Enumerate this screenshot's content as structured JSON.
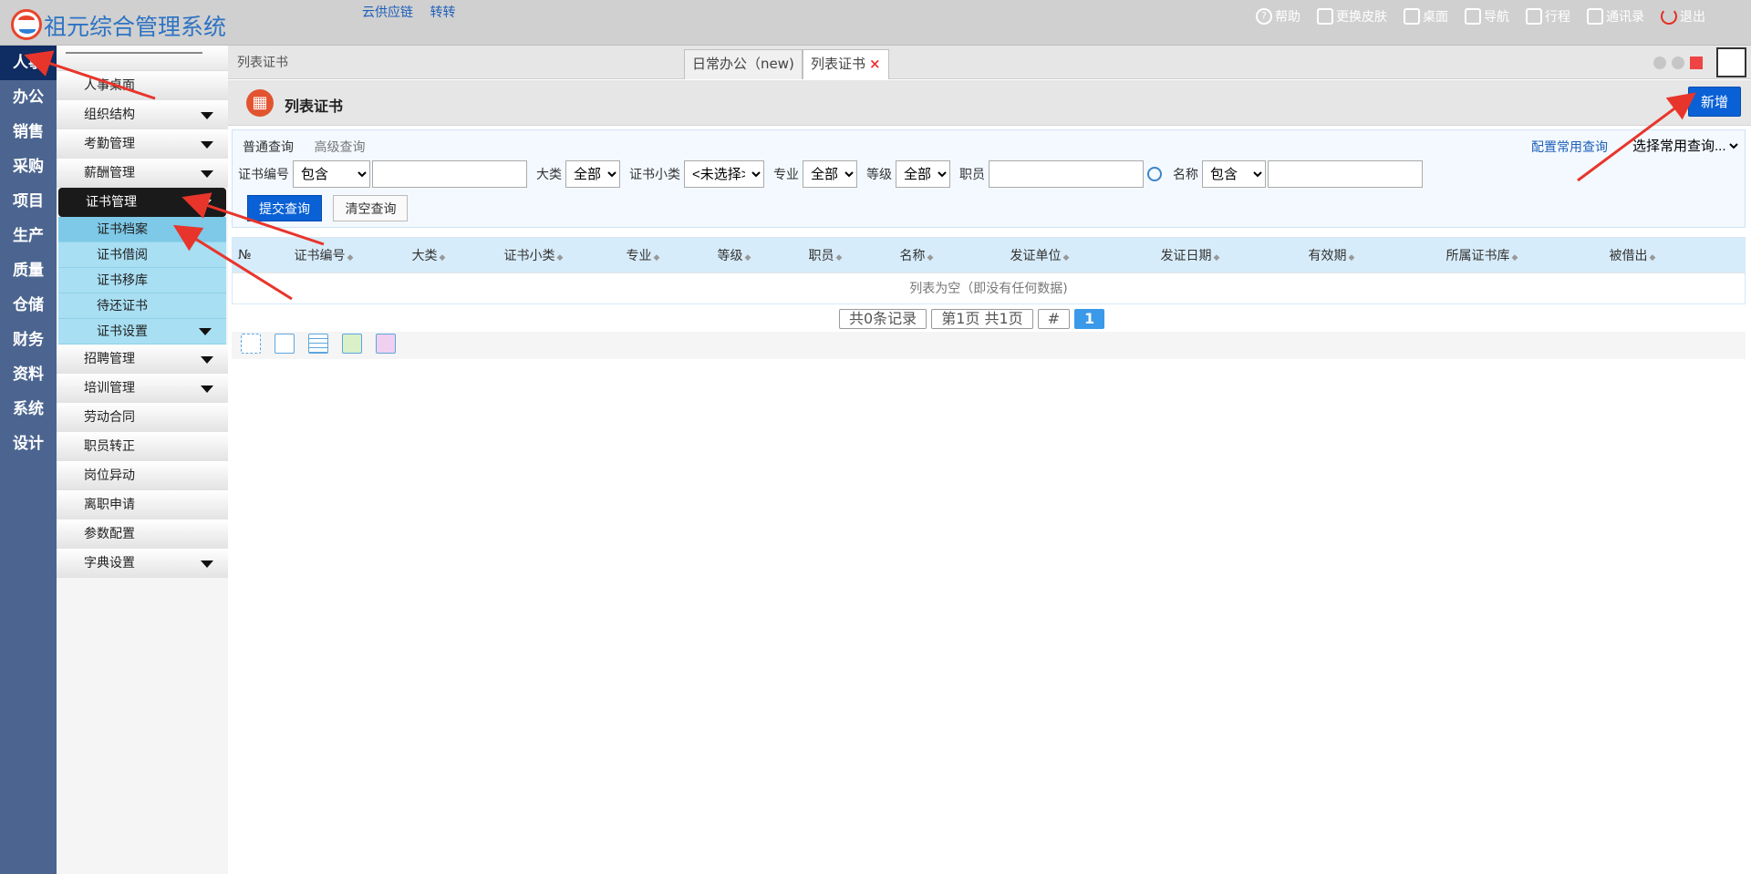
{
  "app": {
    "title": "祖元综合管理系统"
  },
  "toplinks": [
    "云供应链",
    "转转"
  ],
  "tools": [
    {
      "label": "帮助",
      "icon": "help-icon"
    },
    {
      "label": "更换皮肤",
      "icon": "shirt-icon"
    },
    {
      "label": "桌面",
      "icon": "home-icon"
    },
    {
      "label": "导航",
      "icon": "grid-icon"
    },
    {
      "label": "行程",
      "icon": "calendar-icon"
    },
    {
      "label": "通讯录",
      "icon": "contacts-icon"
    },
    {
      "label": "退出",
      "icon": "power-icon"
    }
  ],
  "leftnav": [
    "人事",
    "办公",
    "销售",
    "采购",
    "项目",
    "生产",
    "质量",
    "仓储",
    "财务",
    "资料",
    "系统",
    "设计"
  ],
  "sidebar": {
    "items": [
      {
        "label": "人事桌面"
      },
      {
        "label": "组织结构",
        "arrow": true
      },
      {
        "label": "考勤管理",
        "arrow": true
      },
      {
        "label": "薪酬管理",
        "arrow": true
      },
      {
        "label": "证书管理",
        "arrow": true
      },
      {
        "label": "证书档案"
      },
      {
        "label": "证书借阅"
      },
      {
        "label": "证书移库"
      },
      {
        "label": "待还证书"
      },
      {
        "label": "证书设置",
        "arrow": true
      },
      {
        "label": "招聘管理",
        "arrow": true
      },
      {
        "label": "培训管理",
        "arrow": true
      },
      {
        "label": "劳动合同"
      },
      {
        "label": "职员转正"
      },
      {
        "label": "岗位异动"
      },
      {
        "label": "离职申请"
      },
      {
        "label": "参数配置"
      },
      {
        "label": "字典设置",
        "arrow": true
      }
    ]
  },
  "tabs": {
    "breadcrumb": "列表证书",
    "items": [
      {
        "label": "日常办公（new)"
      },
      {
        "label": "列表证书",
        "close": "×"
      }
    ]
  },
  "page": {
    "title": "列表证书",
    "new_button": "新增"
  },
  "search": {
    "tabs": [
      "普通查询",
      "高级查询"
    ],
    "config_link": "配置常用查询",
    "quick_select": "选择常用查询...",
    "labels": {
      "cert_no": "证书编号",
      "category": "大类",
      "sub": "证书小类",
      "major": "专业",
      "level": "等级",
      "staff": "职员",
      "name": "名称"
    },
    "values": {
      "cert_no_op": "包含",
      "category": "全部",
      "sub": "<未选择>",
      "major": "全部",
      "level": "全部",
      "name_op": "包含"
    },
    "submit": "提交查询",
    "clear": "清空查询"
  },
  "grid": {
    "columns": [
      "№",
      "证书编号",
      "大类",
      "证书小类",
      "专业",
      "等级",
      "职员",
      "名称",
      "发证单位",
      "发证日期",
      "有效期",
      "所属证书库",
      "被借出"
    ],
    "empty": "列表为空（即没有任何数据)",
    "sort_glyph": "◆"
  },
  "pager": {
    "total": "共0条记录",
    "page": "第1页 共1页",
    "hash": "#",
    "current": "1"
  },
  "actions": [
    {
      "icon": "select-icon"
    },
    {
      "icon": "document-icon"
    },
    {
      "icon": "table-icon"
    },
    {
      "icon": "edit-icon"
    },
    {
      "icon": "puzzle-icon"
    }
  ]
}
